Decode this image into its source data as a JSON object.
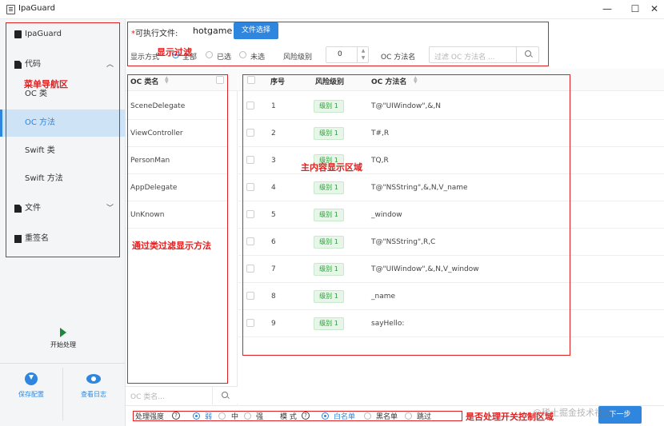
{
  "window": {
    "title": "IpaGuard",
    "minimize": "—",
    "maximize": "☐",
    "close": "✕"
  },
  "sidebar": {
    "ipaguard": "IpaGuard",
    "code": "代码",
    "oc_class": "OC 类",
    "oc_method": "OC 方法",
    "swift_class": "Swift 类",
    "swift_method": "Swift 方法",
    "file": "文件",
    "resign": "重签名",
    "start": "开始处理",
    "save_config": "保存配置",
    "view_log": "查看日志"
  },
  "top": {
    "exec_label": "可执行文件:",
    "exec_required": "*",
    "exec_file": "hotgame",
    "file_select": "文件选择",
    "display_mode": "显示方式",
    "opt_all": "全部",
    "opt_selected": "已选",
    "opt_unselected": "未选",
    "risk_level": "风险级别",
    "risk_value": "0",
    "oc_method_name": "OC 方法名",
    "search_placeholder": "过滤 OC 方法名 ..."
  },
  "class_panel": {
    "header": "OC 类名",
    "items": [
      "SceneDelegate",
      "ViewController",
      "PersonMan",
      "AppDelegate",
      "UnKnown"
    ],
    "search_placeholder": "OC 类名..."
  },
  "table": {
    "columns": [
      "序号",
      "风险级别",
      "OC 方法名"
    ],
    "rows": [
      {
        "no": "1",
        "level": "级别 1",
        "name": "T@\"UIWindow\",&,N"
      },
      {
        "no": "2",
        "level": "级别 1",
        "name": "T#,R"
      },
      {
        "no": "3",
        "level": "级别 1",
        "name": "TQ,R"
      },
      {
        "no": "4",
        "level": "级别 1",
        "name": "T@\"NSString\",&,N,V_name"
      },
      {
        "no": "5",
        "level": "级别 1",
        "name": "_window"
      },
      {
        "no": "6",
        "level": "级别 1",
        "name": "T@\"NSString\",R,C"
      },
      {
        "no": "7",
        "level": "级别 1",
        "name": "T@\"UIWindow\",&,N,V_window"
      },
      {
        "no": "8",
        "level": "级别 1",
        "name": "_name"
      },
      {
        "no": "9",
        "level": "级别 1",
        "name": "sayHello:"
      }
    ]
  },
  "bottom": {
    "strength": "处理强度",
    "weak": "弱",
    "medium": "中",
    "strong": "强",
    "mode": "模 式",
    "whitelist": "白名单",
    "blacklist": "黑名单",
    "skip": "跳过",
    "next": "下一步"
  },
  "annotations": {
    "filter": "显示过滤",
    "menu_nav": "菜单导航区",
    "main_area": "主内容显示区域",
    "class_filter": "通过类过滤显示方法",
    "process_switch": "是否处理开关控制区域"
  },
  "watermark": "@稀土掘金技术社区",
  "colors": {
    "accent": "#2e86de",
    "annotation": "#e02020",
    "tag_green": "#2b9a3a",
    "start_green": "#1a8a3a"
  }
}
